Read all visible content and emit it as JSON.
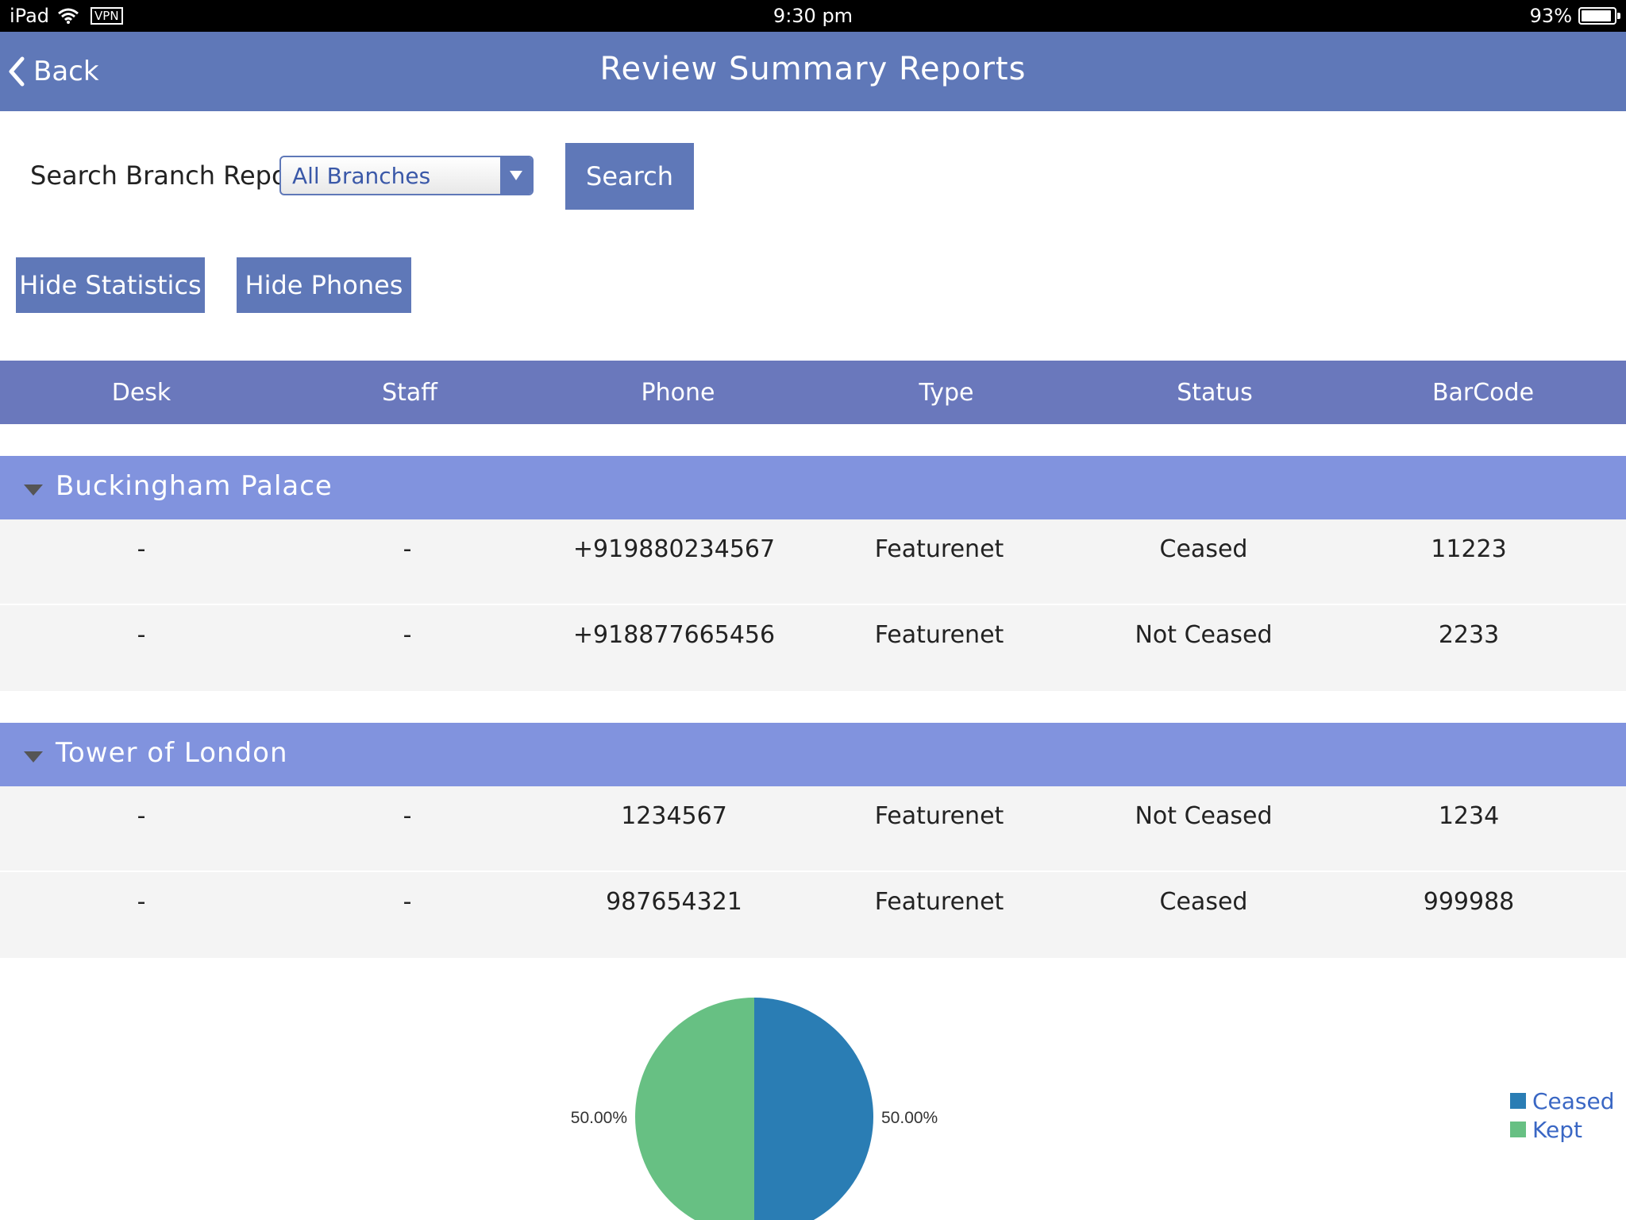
{
  "status_bar": {
    "device": "iPad",
    "vpn": "VPN",
    "time": "9:30 pm",
    "battery": "93%",
    "battery_level": 0.93
  },
  "nav": {
    "back_label": "Back",
    "title": "Review Summary Reports"
  },
  "search": {
    "label": "Search Branch Report",
    "selected_branch": "All Branches",
    "button_label": "Search"
  },
  "toggles": {
    "hide_statistics": "Hide Statistics",
    "hide_phones": "Hide Phones"
  },
  "table": {
    "columns": [
      "Desk",
      "Staff",
      "Phone",
      "Type",
      "Status",
      "BarCode"
    ],
    "groups": [
      {
        "name": "Buckingham Palace",
        "rows": [
          [
            "-",
            "-",
            "+919880234567",
            "Featurenet",
            "Ceased",
            "11223"
          ],
          [
            "-",
            "-",
            "+918877665456",
            "Featurenet",
            "Not Ceased",
            "2233"
          ]
        ]
      },
      {
        "name": "Tower of London",
        "rows": [
          [
            "-",
            "-",
            "1234567",
            "Featurenet",
            "Not Ceased",
            "1234"
          ],
          [
            "-",
            "-",
            "987654321",
            "Featurenet",
            "Ceased",
            "999988"
          ]
        ]
      }
    ]
  },
  "chart_data": {
    "type": "pie",
    "slices": [
      {
        "label": "Ceased",
        "value": 50.0,
        "display": "50.00%",
        "color": "#2a7db4"
      },
      {
        "label": "Kept",
        "value": 50.0,
        "display": "50.00%",
        "color": "#67c083"
      }
    ],
    "legend": [
      "Ceased",
      "Kept"
    ],
    "legend_position": "right"
  },
  "colors": {
    "nav_bar": "#5f78b8",
    "table_header": "#6a78bc",
    "group_header": "#8193de",
    "button": "#5f78b8"
  }
}
